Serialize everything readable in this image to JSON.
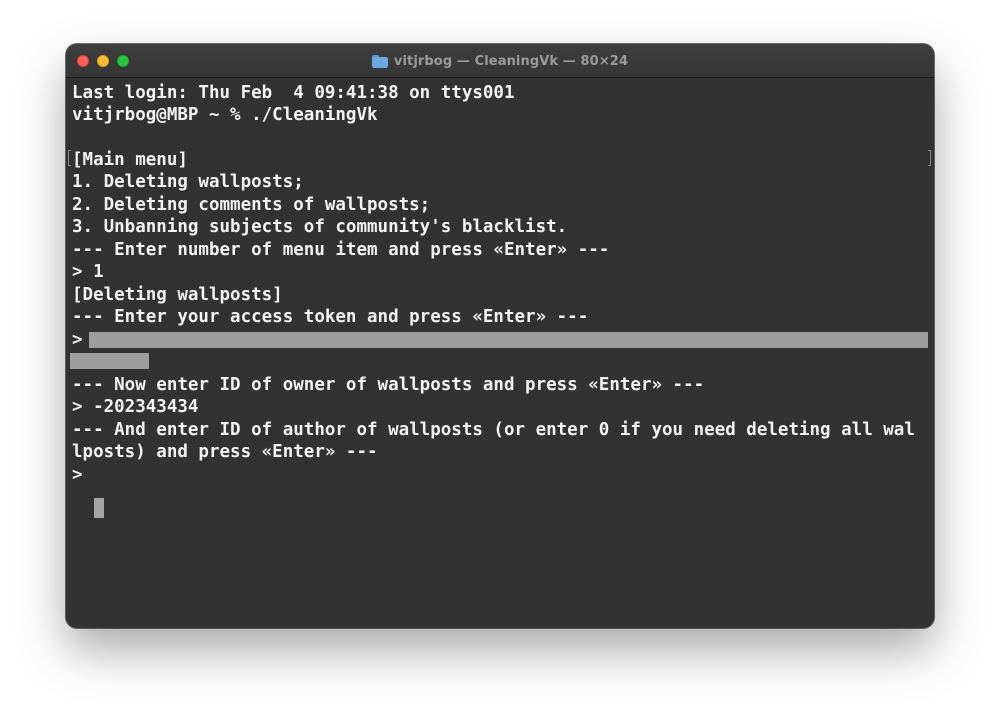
{
  "window": {
    "title": "vitjrbog — CleaningVk — 80×24",
    "title_icon": "folder-icon"
  },
  "terminal": {
    "lines": [
      "Last login: Thu Feb  4 09:41:38 on ttys001",
      "vitjrbog@MBP ~ % ./CleaningVk",
      "",
      "[Main menu]",
      "1. Deleting wallposts;",
      "2. Deleting comments of wallposts;",
      "3. Unbanning subjects of community's blacklist.",
      "--- Enter number of menu item and press «Enter» ---",
      "> 1",
      "[Deleting wallposts]",
      "--- Enter your access token and press «Enter» ---",
      "> ",
      "",
      "--- Now enter ID of owner of wallposts and press «Enter» ---",
      "> -202343434",
      "--- And enter ID of author of wallposts (or enter 0 if you need deleting all wal",
      "lposts) and press «Enter» ---",
      "> "
    ],
    "access_token": "[redacted]"
  },
  "colors": {
    "background": "#323232",
    "text": "#f2f2f2",
    "redaction": "#9e9e9e",
    "cursor": "#a4a4a4"
  }
}
